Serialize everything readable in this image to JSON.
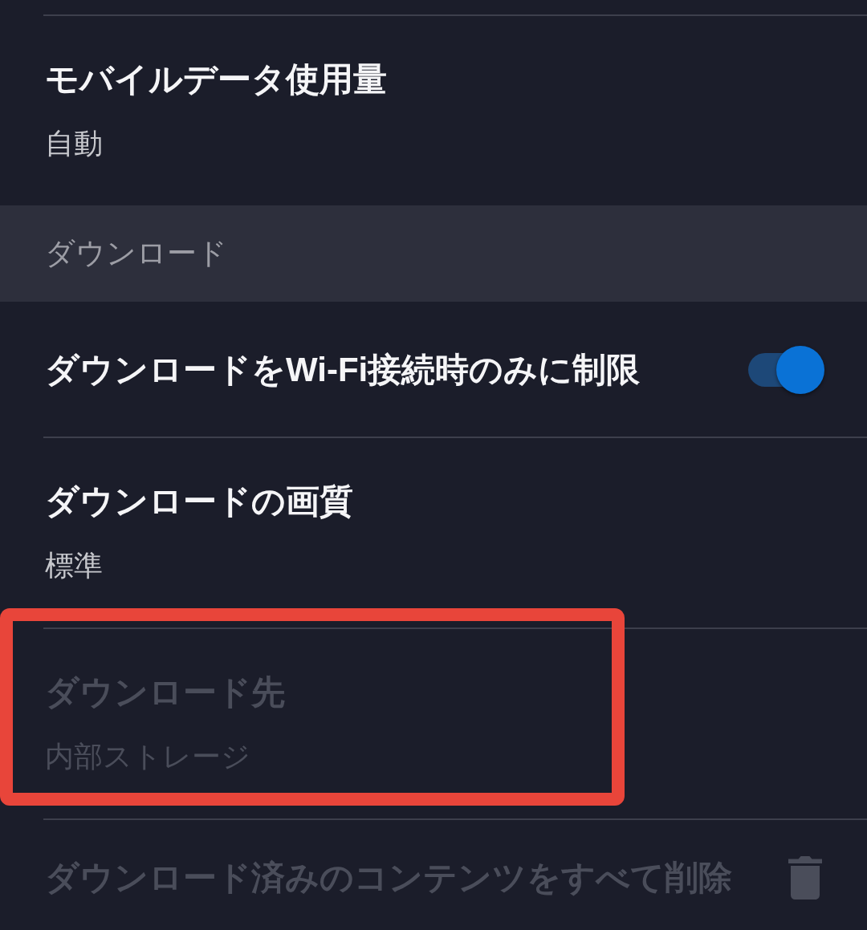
{
  "sections": [
    {
      "items": [
        {
          "kind": "value",
          "title": "モバイルデータ使用量",
          "value": "自動",
          "disabled": false,
          "highlighted": false
        }
      ]
    },
    {
      "header": "ダウンロード",
      "items": [
        {
          "kind": "toggle",
          "title": "ダウンロードをWi-Fi接続時のみに制限",
          "on": true,
          "disabled": false,
          "highlighted": false
        },
        {
          "kind": "value",
          "title": "ダウンロードの画質",
          "value": "標準",
          "disabled": false,
          "highlighted": false
        },
        {
          "kind": "value",
          "title": "ダウンロード先",
          "value": "内部ストレージ",
          "disabled": true,
          "highlighted": true
        },
        {
          "kind": "action",
          "title": "ダウンロード済みのコンテンツをすべて削除",
          "disabled": true,
          "highlighted": false
        }
      ]
    }
  ]
}
